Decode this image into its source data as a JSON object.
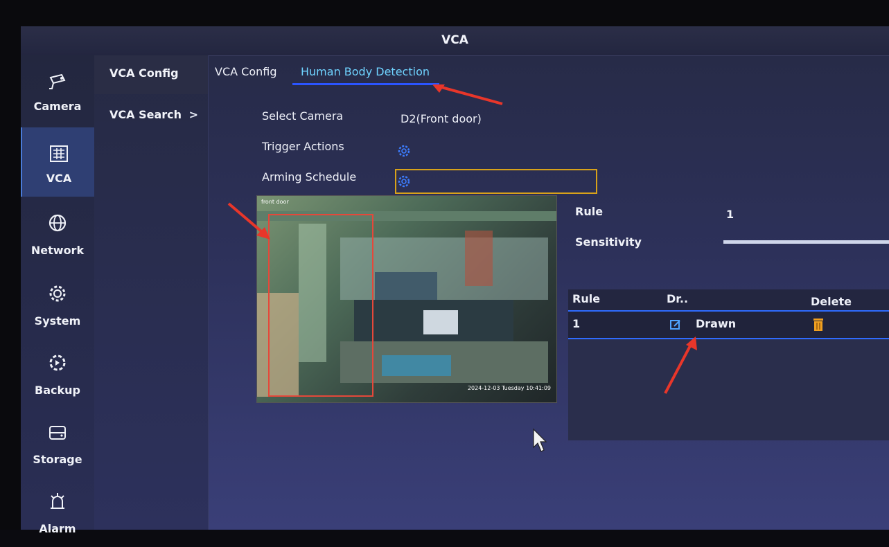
{
  "window": {
    "title": "VCA"
  },
  "nav": {
    "items": [
      {
        "label": "Camera",
        "icon": "camera-icon"
      },
      {
        "label": "VCA",
        "icon": "vca-icon",
        "active": true
      },
      {
        "label": "Network",
        "icon": "network-icon"
      },
      {
        "label": "System",
        "icon": "system-gear-icon"
      },
      {
        "label": "Backup",
        "icon": "backup-icon"
      },
      {
        "label": "Storage",
        "icon": "storage-icon"
      },
      {
        "label": "Alarm",
        "icon": "alarm-icon"
      }
    ]
  },
  "submenu": {
    "items": [
      {
        "label": "VCA Config",
        "active": true
      },
      {
        "label": "VCA Search",
        "chevron": ">"
      }
    ]
  },
  "tabs": [
    {
      "label": "VCA Config"
    },
    {
      "label": "Human Body Detection",
      "active": true
    }
  ],
  "form": {
    "select_camera_label": "Select Camera",
    "select_camera_value": "D2(Front door)",
    "trigger_actions_label": "Trigger Actions",
    "arming_schedule_label": "Arming Schedule"
  },
  "video": {
    "osd_title": "front door",
    "timestamp": "2024-12-03 Tuesday 10:41:09"
  },
  "rule_panel": {
    "rule_label": "Rule",
    "rule_value": "1",
    "sensitivity_label": "Sensitivity"
  },
  "rule_table": {
    "headers": [
      "Rule",
      "Dr..",
      "Delete"
    ],
    "rows": [
      {
        "rule": "1",
        "draw_status": "Drawn"
      }
    ]
  },
  "colors": {
    "accent_blue": "#2f6bff",
    "tab_active_text": "#6fd3ff",
    "highlight_box": "#d8a21a",
    "annotation_red": "#e8362a",
    "delete_icon": "#f0a020"
  }
}
